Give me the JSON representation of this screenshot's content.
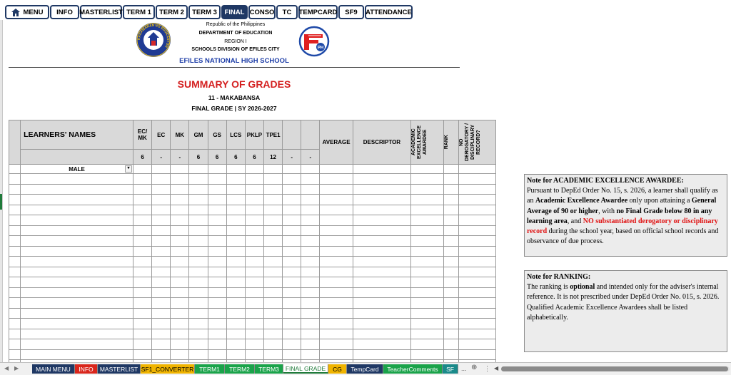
{
  "nav": {
    "menu": "MENU",
    "info": "INFO",
    "masterlist": "MASTERLIST",
    "term1": "TERM 1",
    "term2": "TERM 2",
    "term3": "TERM 3",
    "final": "FINAL",
    "conso": "CONSO",
    "tc": "TC",
    "tempcard": "TEMPCARD",
    "sf9": "SF9",
    "attendance": "ATTENDANCE"
  },
  "header": {
    "republic": "Republic of the Philippines",
    "department": "DEPARTMENT OF EDUCATION",
    "region": "REGION I",
    "division": "SCHOOLS DIVISION OF EFILES CITY",
    "school": "EFILES NATIONAL HIGH SCHOOL",
    "seal_text": "KAGAWARAN NG EDUKASYON",
    "logo_text": "PH"
  },
  "report": {
    "title": "SUMMARY OF GRADES",
    "class": "11 - MAKABANSA",
    "sy": "FINAL GRADE | SY 2026-2027"
  },
  "table": {
    "learners_header": "LEARNERS' NAMES",
    "col_ec_mk": "EC/ MK",
    "col_ec": "EC",
    "col_mk": "MK",
    "col_gm": "GM",
    "col_gs": "GS",
    "col_lcs": "LCS",
    "col_pklp": "PKLP",
    "col_tpe1": "TPE1",
    "col_average": "AVERAGE",
    "col_descriptor": "DESCRIPTOR",
    "col_awardee": "ACADEMIC EXCELLENCE AWARDEE",
    "col_rank": "RANK",
    "col_derog": "NO DEROGATORY / DISCIPLINARY RECORD?",
    "sub_values": [
      "6",
      "-",
      "-",
      "6",
      "6",
      "6",
      "6",
      "12",
      "-",
      "-"
    ],
    "male_label": "MALE"
  },
  "notes": {
    "n1_title": "Note for ACADEMIC EXCELLENCE AWARDEE:",
    "n1_a": "Pursuant to DepEd Order No. 15, s. 2026, a learner shall qualify as an ",
    "n1_b": "Academic Excellence Awardee",
    "n1_c": " only upon attaining a ",
    "n1_d": "General Average of 90 or higher",
    "n1_e": ", with ",
    "n1_f": "no Final Grade below 80 in any learning area",
    "n1_g": ", and ",
    "n1_h": "NO substantiated derogatory or disciplinary record",
    "n1_i": " during the school year, based on official school records and observance of due process.",
    "n2_title": "Note for RANKING:",
    "n2_a": "The ranking is ",
    "n2_b": "optional",
    "n2_c": " and intended only for the adviser's internal reference. It is not prescribed under DepEd Order No. 015, s. 2026. Qualified Academic Excellence Awardees shall be listed alphabetically."
  },
  "tabs": {
    "main_menu": "MAIN MENU",
    "info": "INFO",
    "masterlist": "MASTERLIST",
    "sf1": "SF1_CONVERTER",
    "term1": "TERM1",
    "term2": "TERM2",
    "term3": "TERM3",
    "final": "FINAL GRADE",
    "cg": "CG",
    "tempcard": "TempCard",
    "teacher": "TeacherComments",
    "sf": "SF",
    "more": "..."
  },
  "colors": {
    "nav_border": "#1f3864",
    "red_text": "#e01010",
    "school_blue": "#1f3fa8",
    "tab_navy": "#1f3864",
    "tab_red": "#d9261c",
    "tab_yellow": "#f0b400",
    "tab_green": "#1aa34a",
    "tab_teal": "#1a8a8a"
  }
}
